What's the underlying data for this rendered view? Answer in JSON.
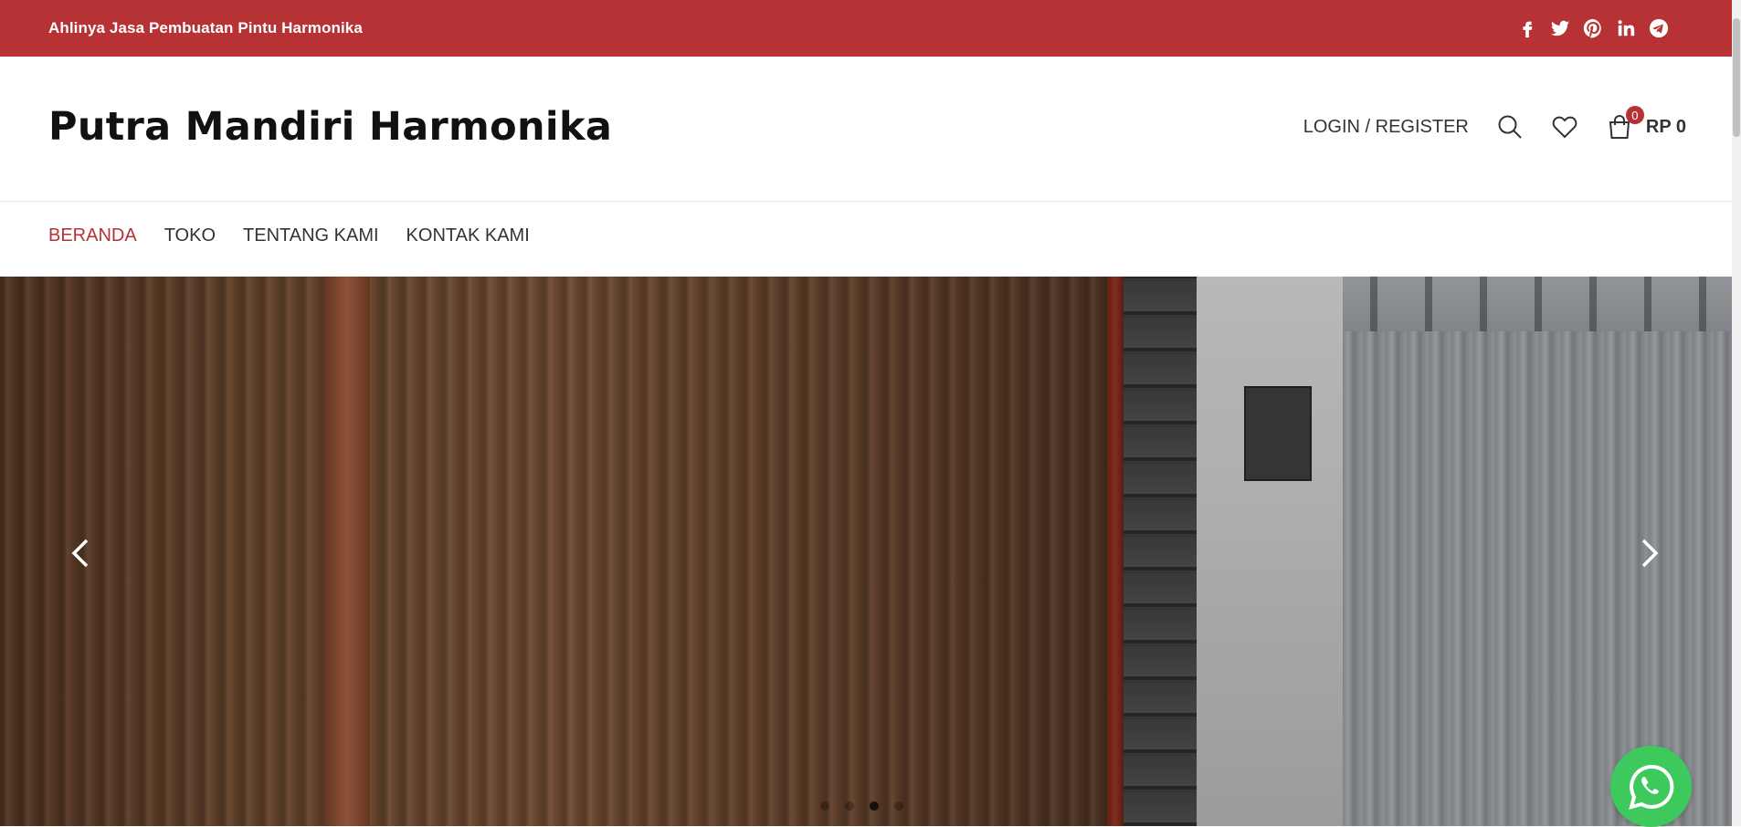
{
  "topbar": {
    "tagline": "Ahlinya Jasa Pembuatan Pintu Harmonika",
    "background_color": "#b63234",
    "socials": [
      {
        "name": "facebook-icon"
      },
      {
        "name": "twitter-icon"
      },
      {
        "name": "pinterest-icon"
      },
      {
        "name": "linkedin-icon"
      },
      {
        "name": "telegram-icon"
      }
    ]
  },
  "header": {
    "logo": "Putra Mandiri Harmonika",
    "login_label": "LOGIN / REGISTER",
    "cart_count": "0",
    "cart_total": "RP 0"
  },
  "nav": {
    "items": [
      {
        "label": "BERANDA",
        "active": true
      },
      {
        "label": "TOKO",
        "active": false
      },
      {
        "label": "TENTANG KAMI",
        "active": false
      },
      {
        "label": "KONTAK KAMI",
        "active": false
      }
    ]
  },
  "slider": {
    "dots": 4,
    "active_dot": 3
  },
  "colors": {
    "accent": "#b63234",
    "whatsapp": "#3ec95c"
  }
}
